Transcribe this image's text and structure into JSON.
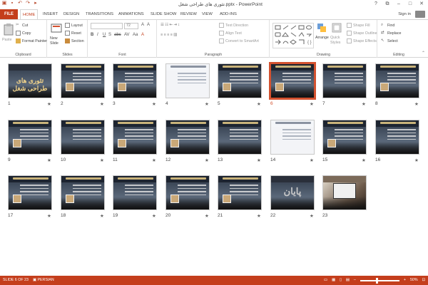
{
  "window": {
    "title": "تئوری های طراحی شغل.pptx - PowerPoint",
    "sign_in": "Sign in"
  },
  "tabs": [
    "FILE",
    "HOME",
    "INSERT",
    "DESIGN",
    "TRANSITIONS",
    "ANIMATIONS",
    "SLIDE SHOW",
    "REVIEW",
    "VIEW",
    "ADD-INS"
  ],
  "ribbon": {
    "clipboard": {
      "label": "Clipboard",
      "paste": "Paste",
      "cut": "Cut",
      "copy": "Copy",
      "format_painter": "Format Painter"
    },
    "slides": {
      "label": "Slides",
      "new_slide": "New Slide",
      "layout": "Layout",
      "reset": "Reset",
      "section": "Section"
    },
    "font": {
      "label": "Font",
      "font_size": "72",
      "buttons": [
        "B",
        "I",
        "U",
        "S",
        "abc",
        "AV",
        "Aa",
        "A"
      ]
    },
    "paragraph": {
      "label": "Paragraph",
      "text_direction": "Text Direction",
      "align_text": "Align Text",
      "convert_smartart": "Convert to SmartArt"
    },
    "drawing": {
      "label": "Drawing",
      "arrange": "Arrange",
      "quick_styles": "Quick Styles",
      "shape_fill": "Shape Fill",
      "shape_outline": "Shape Outline",
      "shape_effects": "Shape Effects"
    },
    "editing": {
      "label": "Editing",
      "find": "Find",
      "replace": "Replace",
      "select": "Select"
    }
  },
  "slides": [
    {
      "num": "1",
      "star": "★",
      "title": "تئوری های طراحی شغل",
      "style": "title",
      "selected": false
    },
    {
      "num": "2",
      "star": "★",
      "style": "dark",
      "selected": false
    },
    {
      "num": "3",
      "star": "★",
      "style": "dark",
      "selected": false
    },
    {
      "num": "4",
      "star": "★",
      "style": "light",
      "selected": false
    },
    {
      "num": "5",
      "star": "★",
      "style": "dark",
      "selected": false
    },
    {
      "num": "6",
      "star": "★",
      "style": "dark",
      "selected": true
    },
    {
      "num": "7",
      "star": "★",
      "style": "dark",
      "selected": false
    },
    {
      "num": "8",
      "star": "★",
      "style": "dark",
      "selected": false
    },
    {
      "num": "9",
      "star": "★",
      "style": "dark",
      "selected": false
    },
    {
      "num": "10",
      "star": "★",
      "style": "dark",
      "selected": false
    },
    {
      "num": "11",
      "star": "★",
      "style": "dark",
      "selected": false
    },
    {
      "num": "12",
      "star": "★",
      "style": "dark",
      "selected": false
    },
    {
      "num": "13",
      "star": "★",
      "style": "dark",
      "selected": false
    },
    {
      "num": "14",
      "star": "★",
      "style": "light",
      "selected": false
    },
    {
      "num": "15",
      "star": "★",
      "style": "dark",
      "selected": false
    },
    {
      "num": "16",
      "star": "★",
      "style": "dark",
      "selected": false
    },
    {
      "num": "17",
      "star": "★",
      "style": "dark",
      "selected": false
    },
    {
      "num": "18",
      "star": "★",
      "style": "dark",
      "selected": false
    },
    {
      "num": "19",
      "star": "★",
      "style": "dark",
      "selected": false
    },
    {
      "num": "20",
      "star": "★",
      "style": "dark",
      "selected": false
    },
    {
      "num": "21",
      "star": "★",
      "style": "dark",
      "selected": false
    },
    {
      "num": "22",
      "star": "★",
      "title": "پایان",
      "style": "end",
      "selected": false
    },
    {
      "num": "23",
      "star": "",
      "style": "photo",
      "selected": false
    }
  ],
  "status": {
    "slide_info": "SLIDE 6 OF 23",
    "language": "PERSIAN",
    "zoom": "50%"
  },
  "colors": {
    "accent": "#c43e1c",
    "selected_outline": "#d35230"
  }
}
